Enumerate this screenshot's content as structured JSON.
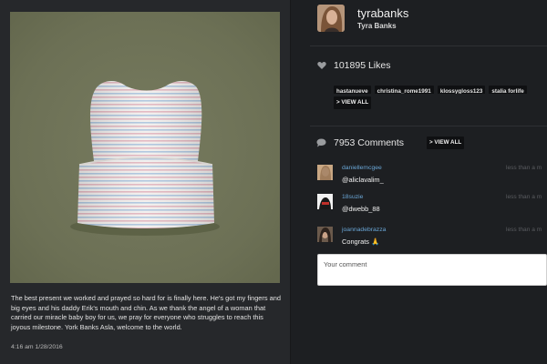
{
  "post": {
    "caption": "The best present we worked and prayed so hard for is finally here. He's got my fingers and big eyes and his daddy Erik's mouth and chin. As we thank the angel of a woman that carried our miracle baby boy for us, we pray for everyone who struggles to reach this joyous milestone. York Banks Asla, welcome to the world.",
    "timestamp": "4:16 am 1/28/2016"
  },
  "profile": {
    "username": "tyrabanks",
    "full_name": "Tyra Banks"
  },
  "likes": {
    "count_label": "101895 Likes",
    "likers": [
      "hastanueve",
      "christina_rome1991",
      "klossygloss123",
      "stalia forlife"
    ],
    "view_all_label": "> VIEW ALL"
  },
  "comments": {
    "count_label": "7953 Comments",
    "view_all_label": "> VIEW ALL",
    "items": [
      {
        "user": "daniellemcgee",
        "text": "@aliclavalim_",
        "time": "less than a m"
      },
      {
        "user": "18suzie",
        "text": "@dwebb_88",
        "time": "less than a m"
      },
      {
        "user": "joannadebrazza",
        "text": "Congrats 🙏",
        "time": "less than a m"
      }
    ],
    "input_placeholder": "Your comment"
  },
  "colors": {
    "background": "#1d1f22",
    "panel": "#26282b",
    "link": "#6aa6d6",
    "tag_bg": "#0f1012"
  },
  "icons": {
    "likes": "heart-icon",
    "comments": "speech-bubble-icon"
  }
}
